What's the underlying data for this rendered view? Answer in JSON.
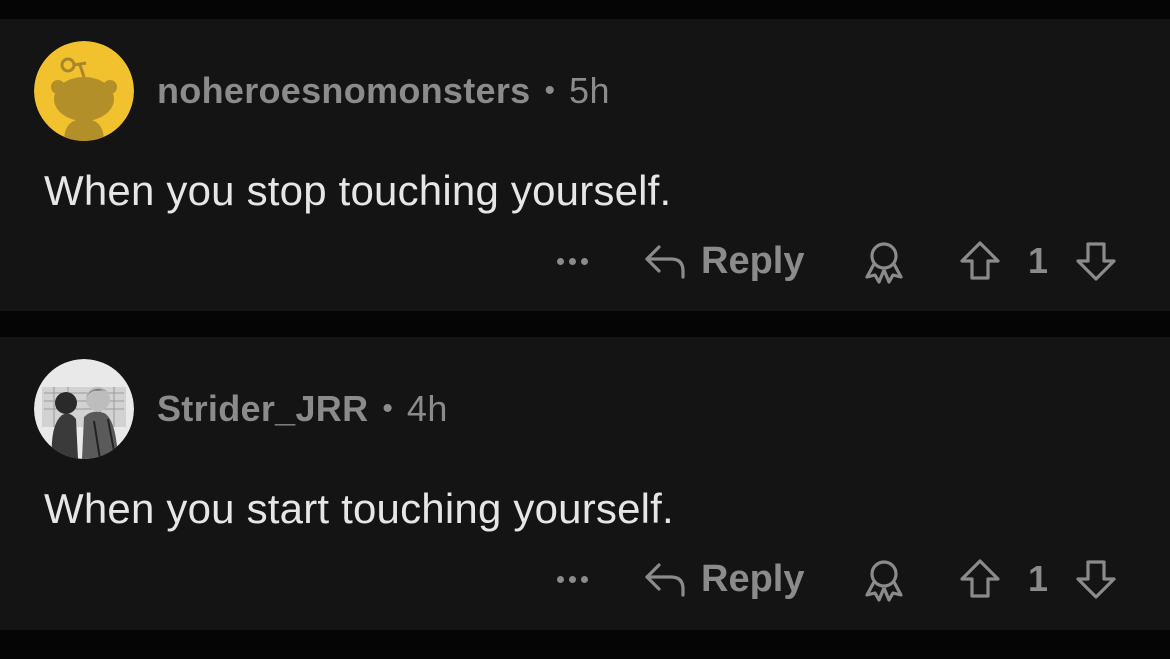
{
  "comments": [
    {
      "username": "noheroesnomonsters",
      "separator": "•",
      "time": "5h",
      "body": "When you stop touching yourself.",
      "reply_label": "Reply",
      "vote_count": "1",
      "avatar": "snoo-avatar-yellow"
    },
    {
      "username": "Strider_JRR",
      "separator": "•",
      "time": "4h",
      "body": "When you start touching yourself.",
      "reply_label": "Reply",
      "vote_count": "1",
      "avatar": "manga-illustration-avatar"
    }
  ],
  "icons": {
    "more": "more-horizontal-icon",
    "reply": "reply-arrow-icon",
    "award": "award-ribbon-icon",
    "upvote": "upvote-arrow-icon",
    "downvote": "downvote-arrow-icon"
  },
  "colors": {
    "background": "#050505",
    "card": "#141414",
    "text_primary": "#e6e6e6",
    "text_secondary": "#8b8b8b",
    "avatar_yellow": "#f2c12e"
  }
}
